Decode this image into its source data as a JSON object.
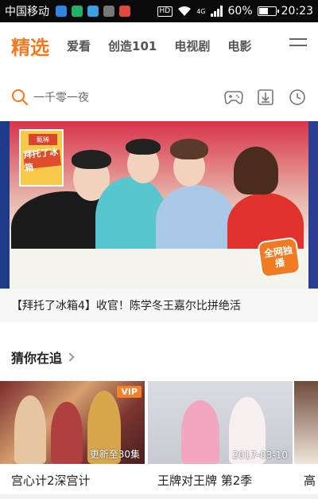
{
  "status_bar": {
    "carrier": "中国移动",
    "network": "4G",
    "hd": "HD",
    "battery_percent_label": "60%",
    "battery_level": 0.6,
    "time": "20:23",
    "notif_colors": [
      "#2e86de",
      "#20b26b",
      "#3aa0e0",
      "#555",
      "#e0483d"
    ]
  },
  "nav": {
    "tabs": [
      "精选",
      "爱看",
      "创造101",
      "电视剧",
      "电影"
    ],
    "active_index": 0,
    "accent_color": "#f27a22"
  },
  "search": {
    "placeholder": "一千零一夜",
    "actions": [
      "gamepad-icon",
      "download-icon",
      "history-clock-icon"
    ]
  },
  "banner": {
    "logo_text": "拜托了冰箱",
    "logo_brand": "甄稀",
    "badge_text": "全网独播",
    "caption": "【拜托了冰箱4】收官！陈学冬王嘉尔比拼绝活"
  },
  "section": {
    "title": "猜你在追"
  },
  "cards": [
    {
      "title": "宫心计2深宫计",
      "badge": "VIP",
      "overlay": "更新至30集"
    },
    {
      "title": "王牌对王牌 第2季",
      "badge": "",
      "overlay": "2017-03-10"
    },
    {
      "title": "高",
      "badge": "",
      "overlay": ""
    }
  ]
}
